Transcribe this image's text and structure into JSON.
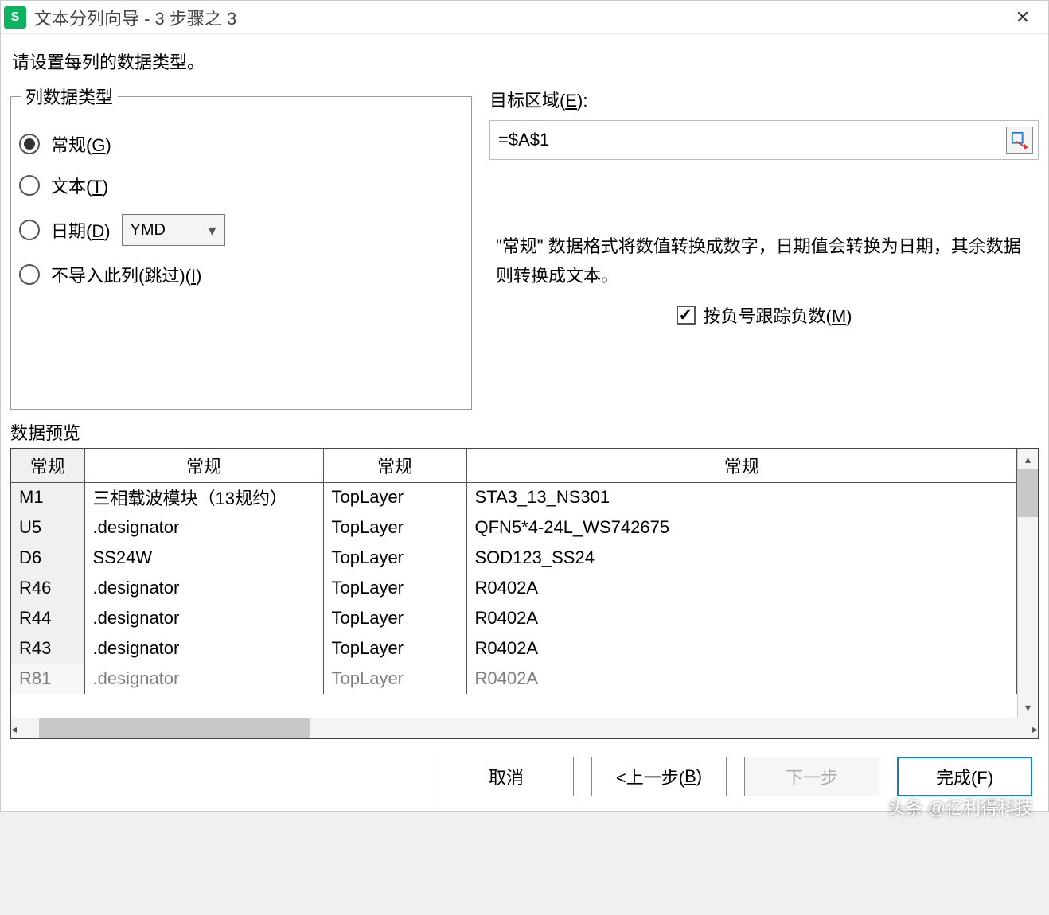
{
  "titlebar": {
    "app_glyph": "S",
    "title": "文本分列向导 - 3 步骤之 3"
  },
  "instruction": "请设置每列的数据类型。",
  "type_group": {
    "legend": "列数据类型",
    "options": {
      "general": "常规(G)",
      "text": "文本(T)",
      "date": "日期(D)",
      "skip": "不导入此列(跳过)(I)"
    },
    "date_format": "YMD"
  },
  "target": {
    "label": "目标区域(E):",
    "value": "=$A$1"
  },
  "hint": "\"常规\" 数据格式将数值转换成数字，日期值会转换为日期，其余数据则转换成文本。",
  "negative_checkbox": "按负号跟踪负数(M)",
  "preview": {
    "label": "数据预览",
    "headers": [
      "常规",
      "常规",
      "常规",
      "常规"
    ],
    "rows": [
      [
        "M1",
        "三相载波模块（13规约）",
        "TopLayer",
        "STA3_13_NS301"
      ],
      [
        "U5",
        ".designator",
        "TopLayer",
        "QFN5*4-24L_WS742675"
      ],
      [
        "D6",
        "SS24W",
        "TopLayer",
        "SOD123_SS24"
      ],
      [
        "R46",
        ".designator",
        "TopLayer",
        "R0402A"
      ],
      [
        "R44",
        ".designator",
        "TopLayer",
        "R0402A"
      ],
      [
        "R43",
        ".designator",
        "TopLayer",
        "R0402A"
      ],
      [
        "R81",
        ".designator",
        "TopLayer",
        "R0402A"
      ]
    ]
  },
  "buttons": {
    "cancel": "取消",
    "back": "<上一步(B)",
    "next": "下一步",
    "finish": "完成(F)"
  },
  "watermark": "头条 @亿利得科技"
}
